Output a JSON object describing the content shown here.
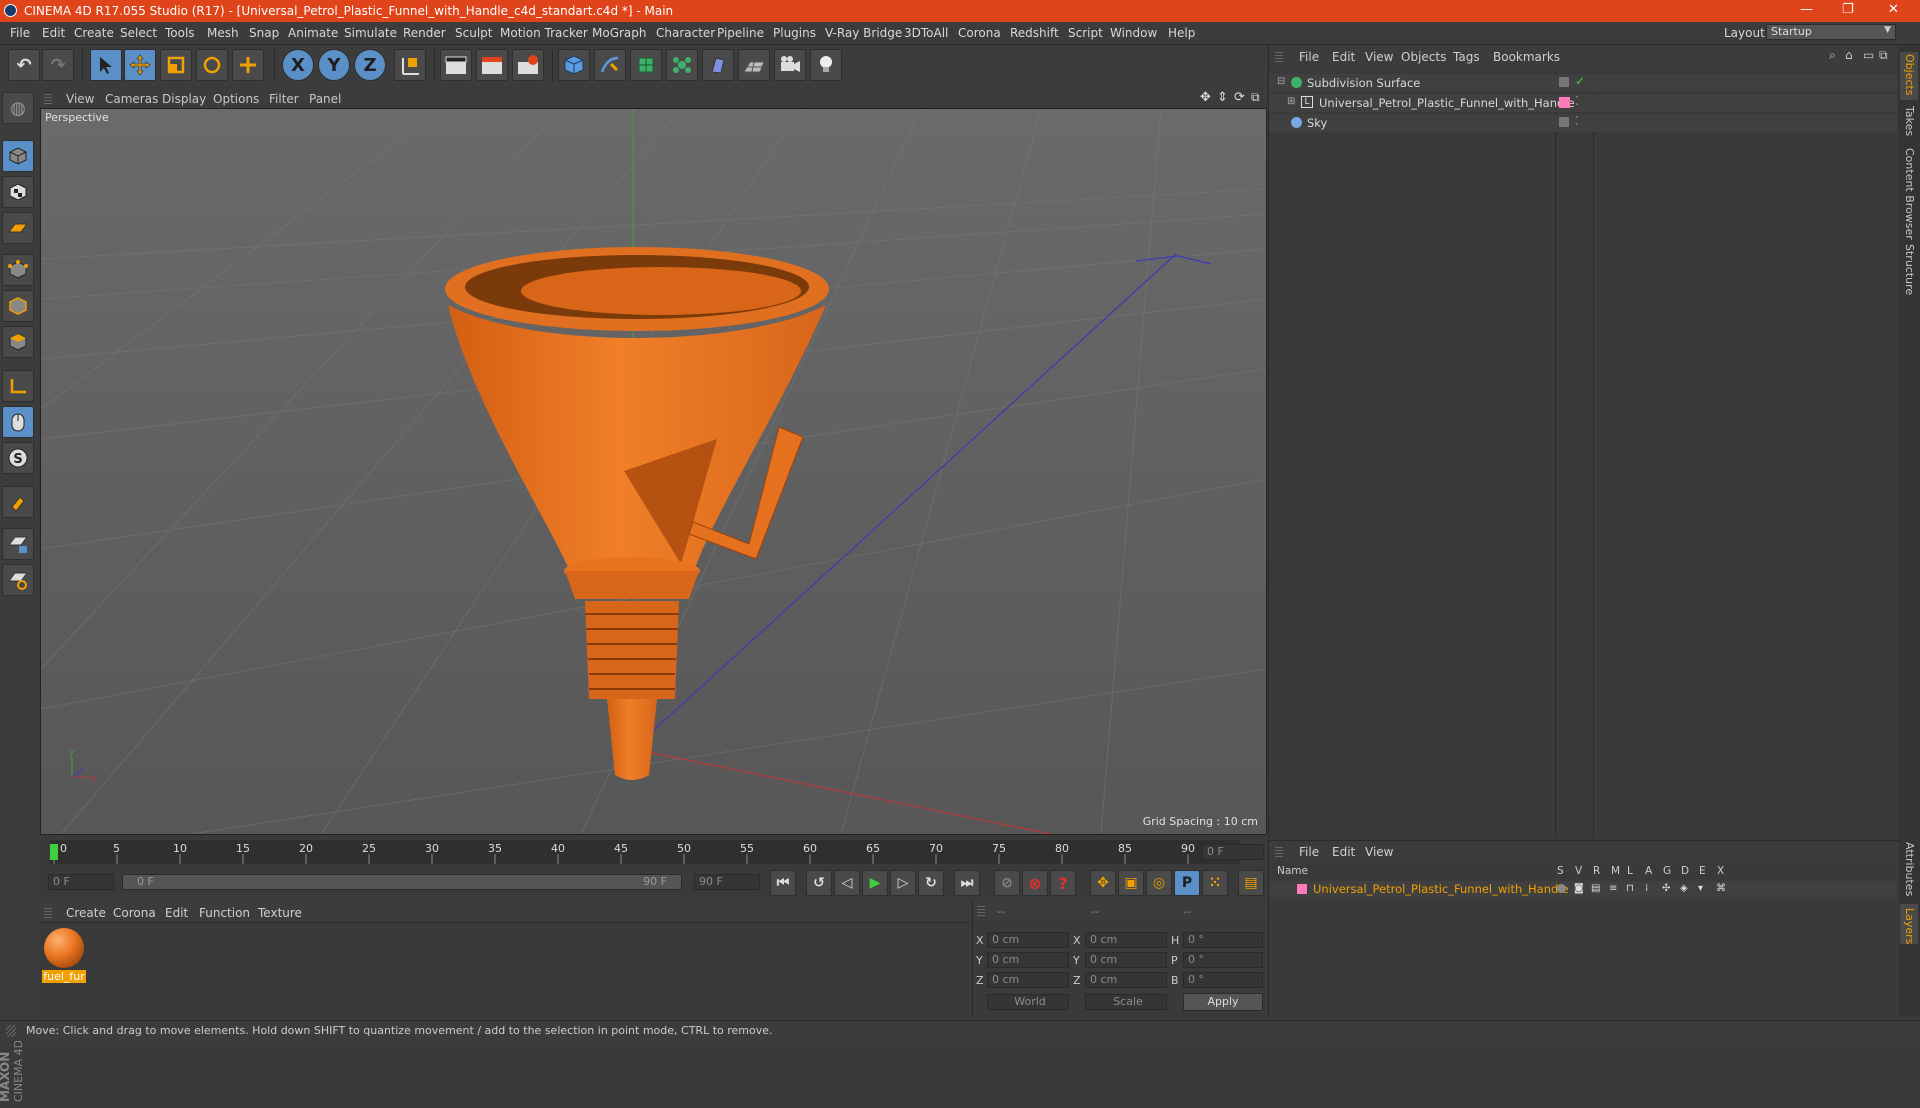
{
  "window": {
    "title": "CINEMA 4D R17.055 Studio (R17) - [Universal_Petrol_Plastic_Funnel_with_Handle_c4d_standart.c4d *] - Main",
    "controls": [
      "—",
      "❐",
      "✕"
    ]
  },
  "menubar": {
    "items": [
      "File",
      "Edit",
      "Create",
      "Select",
      "Tools",
      "Mesh",
      "Snap",
      "Animate",
      "Simulate",
      "Render",
      "Sculpt",
      "Motion Tracker",
      "MoGraph",
      "Character",
      "Pipeline",
      "Plugins",
      "V-Ray Bridge",
      "3DToAll",
      "Corona",
      "Redshift",
      "Script",
      "Window",
      "Help"
    ],
    "layout_label": "Layout:",
    "layout_value": "Startup"
  },
  "toolbar": {
    "axis_x": "X",
    "axis_y": "Y",
    "axis_z": "Z"
  },
  "viewport": {
    "menu": [
      "View",
      "Cameras",
      "Display",
      "Options",
      "Filter",
      "Panel"
    ],
    "label": "Perspective",
    "grid_spacing": "Grid Spacing : 10 cm"
  },
  "object_manager": {
    "menu": [
      "File",
      "Edit",
      "View",
      "Objects",
      "Tags",
      "Bookmarks"
    ],
    "objects": [
      {
        "name": "Subdivision Surface"
      },
      {
        "name": "Universal_Petrol_Plastic_Funnel_with_Handle"
      },
      {
        "name": "Sky"
      }
    ]
  },
  "side_tabs": [
    "Objects",
    "Takes",
    "Content Browser",
    "Structure",
    "Attributes",
    "Layers"
  ],
  "timeline": {
    "ticks": [
      "0",
      "5",
      "10",
      "15",
      "20",
      "25",
      "30",
      "35",
      "40",
      "45",
      "50",
      "55",
      "60",
      "65",
      "70",
      "75",
      "80",
      "85",
      "90"
    ],
    "current_frame": "0 F",
    "start_field": "0 F",
    "range_start": "0 F",
    "range_end": "90 F",
    "end_field": "90 F"
  },
  "material_manager": {
    "menu": [
      "Create",
      "Corona",
      "Edit",
      "Function",
      "Texture"
    ],
    "material_name": "fuel_fur"
  },
  "coordinates": {
    "headers": [
      "--",
      "--",
      "--"
    ],
    "rows": [
      {
        "a": "X",
        "av": "0 cm",
        "b": "X",
        "bv": "0 cm",
        "c": "H",
        "cv": "0 °"
      },
      {
        "a": "Y",
        "av": "0 cm",
        "b": "Y",
        "bv": "0 cm",
        "c": "P",
        "cv": "0 °"
      },
      {
        "a": "Z",
        "av": "0 cm",
        "b": "Z",
        "bv": "0 cm",
        "c": "B",
        "cv": "0 °"
      }
    ],
    "mode1": "World",
    "mode2": "Scale",
    "apply": "Apply"
  },
  "layer_manager": {
    "menu": [
      "File",
      "Edit",
      "View"
    ],
    "col_name": "Name",
    "cols": [
      "S",
      "V",
      "R",
      "M",
      "L",
      "A",
      "G",
      "D",
      "E",
      "X"
    ],
    "layer_name": "Universal_Petrol_Plastic_Funnel_with_Handle"
  },
  "logo": {
    "line1": "MAXON",
    "line2": "CINEMA 4D"
  },
  "status": "Move: Click and drag to move elements. Hold down SHIFT to quantize movement / add to the selection in point mode, CTRL to remove.",
  "colors": {
    "accent": "#e0441b",
    "funnel": "#e8731e",
    "layer_text": "#f0a000"
  }
}
